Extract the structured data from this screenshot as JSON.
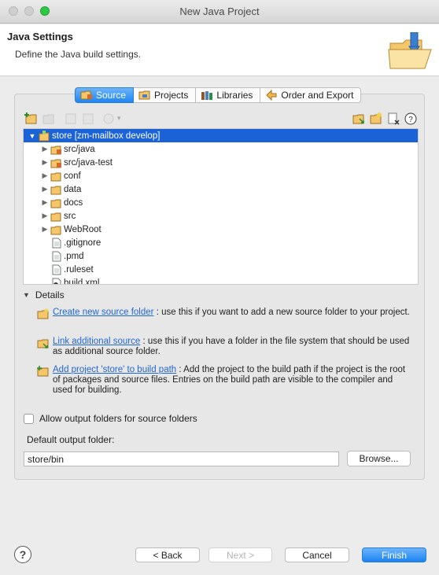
{
  "window": {
    "title": "New Java Project"
  },
  "header": {
    "title": "Java Settings",
    "description": "Define the Java build settings."
  },
  "tabs": [
    {
      "label": "Source",
      "icon": "source-folder-icon",
      "active": true
    },
    {
      "label": "Projects",
      "icon": "projects-icon",
      "active": false
    },
    {
      "label": "Libraries",
      "icon": "libraries-icon",
      "active": false
    },
    {
      "label": "Order and Export",
      "icon": "order-export-icon",
      "active": false
    }
  ],
  "tree": {
    "root": {
      "label": "store [zm-mailbox develop]",
      "icon": "project-icon"
    },
    "items": [
      {
        "label": "src/java",
        "icon": "package-folder-icon",
        "expandable": true
      },
      {
        "label": "src/java-test",
        "icon": "package-folder-icon",
        "expandable": true
      },
      {
        "label": "conf",
        "icon": "folder-icon",
        "expandable": true
      },
      {
        "label": "data",
        "icon": "folder-icon",
        "expandable": true
      },
      {
        "label": "docs",
        "icon": "folder-icon",
        "expandable": true
      },
      {
        "label": "src",
        "icon": "folder-icon",
        "expandable": true
      },
      {
        "label": "WebRoot",
        "icon": "folder-icon",
        "expandable": true
      },
      {
        "label": ".gitignore",
        "icon": "file-icon",
        "expandable": false
      },
      {
        "label": ".pmd",
        "icon": "file-icon",
        "expandable": false
      },
      {
        "label": ".ruleset",
        "icon": "file-icon",
        "expandable": false
      },
      {
        "label": "build.xml",
        "icon": "ant-file-icon",
        "expandable": false
      }
    ]
  },
  "details": {
    "label": "Details",
    "items": [
      {
        "link": "Create new source folder",
        "text": ": use this if you want to add a new source folder to your project."
      },
      {
        "link": "Link additional source",
        "text": ": use this if you have a folder in the file system that should be used as additional source folder."
      },
      {
        "link": "Add project 'store' to build path",
        "text": ": Add the project to the build path if the project is the root of packages and source files. Entries on the build path are visible to the compiler and used for building."
      }
    ]
  },
  "options": {
    "allow_output_label": "Allow output folders for source folders",
    "allow_output_checked": false
  },
  "output": {
    "label": "Default output folder:",
    "value": "store/bin",
    "browse": "Browse..."
  },
  "footer": {
    "back": "< Back",
    "next": "Next >",
    "cancel": "Cancel",
    "finish": "Finish",
    "help": "?"
  },
  "colors": {
    "accent": "#1f86f1",
    "selection": "#1a62d6",
    "link": "#2267d2",
    "folder": "#f2b84b"
  }
}
